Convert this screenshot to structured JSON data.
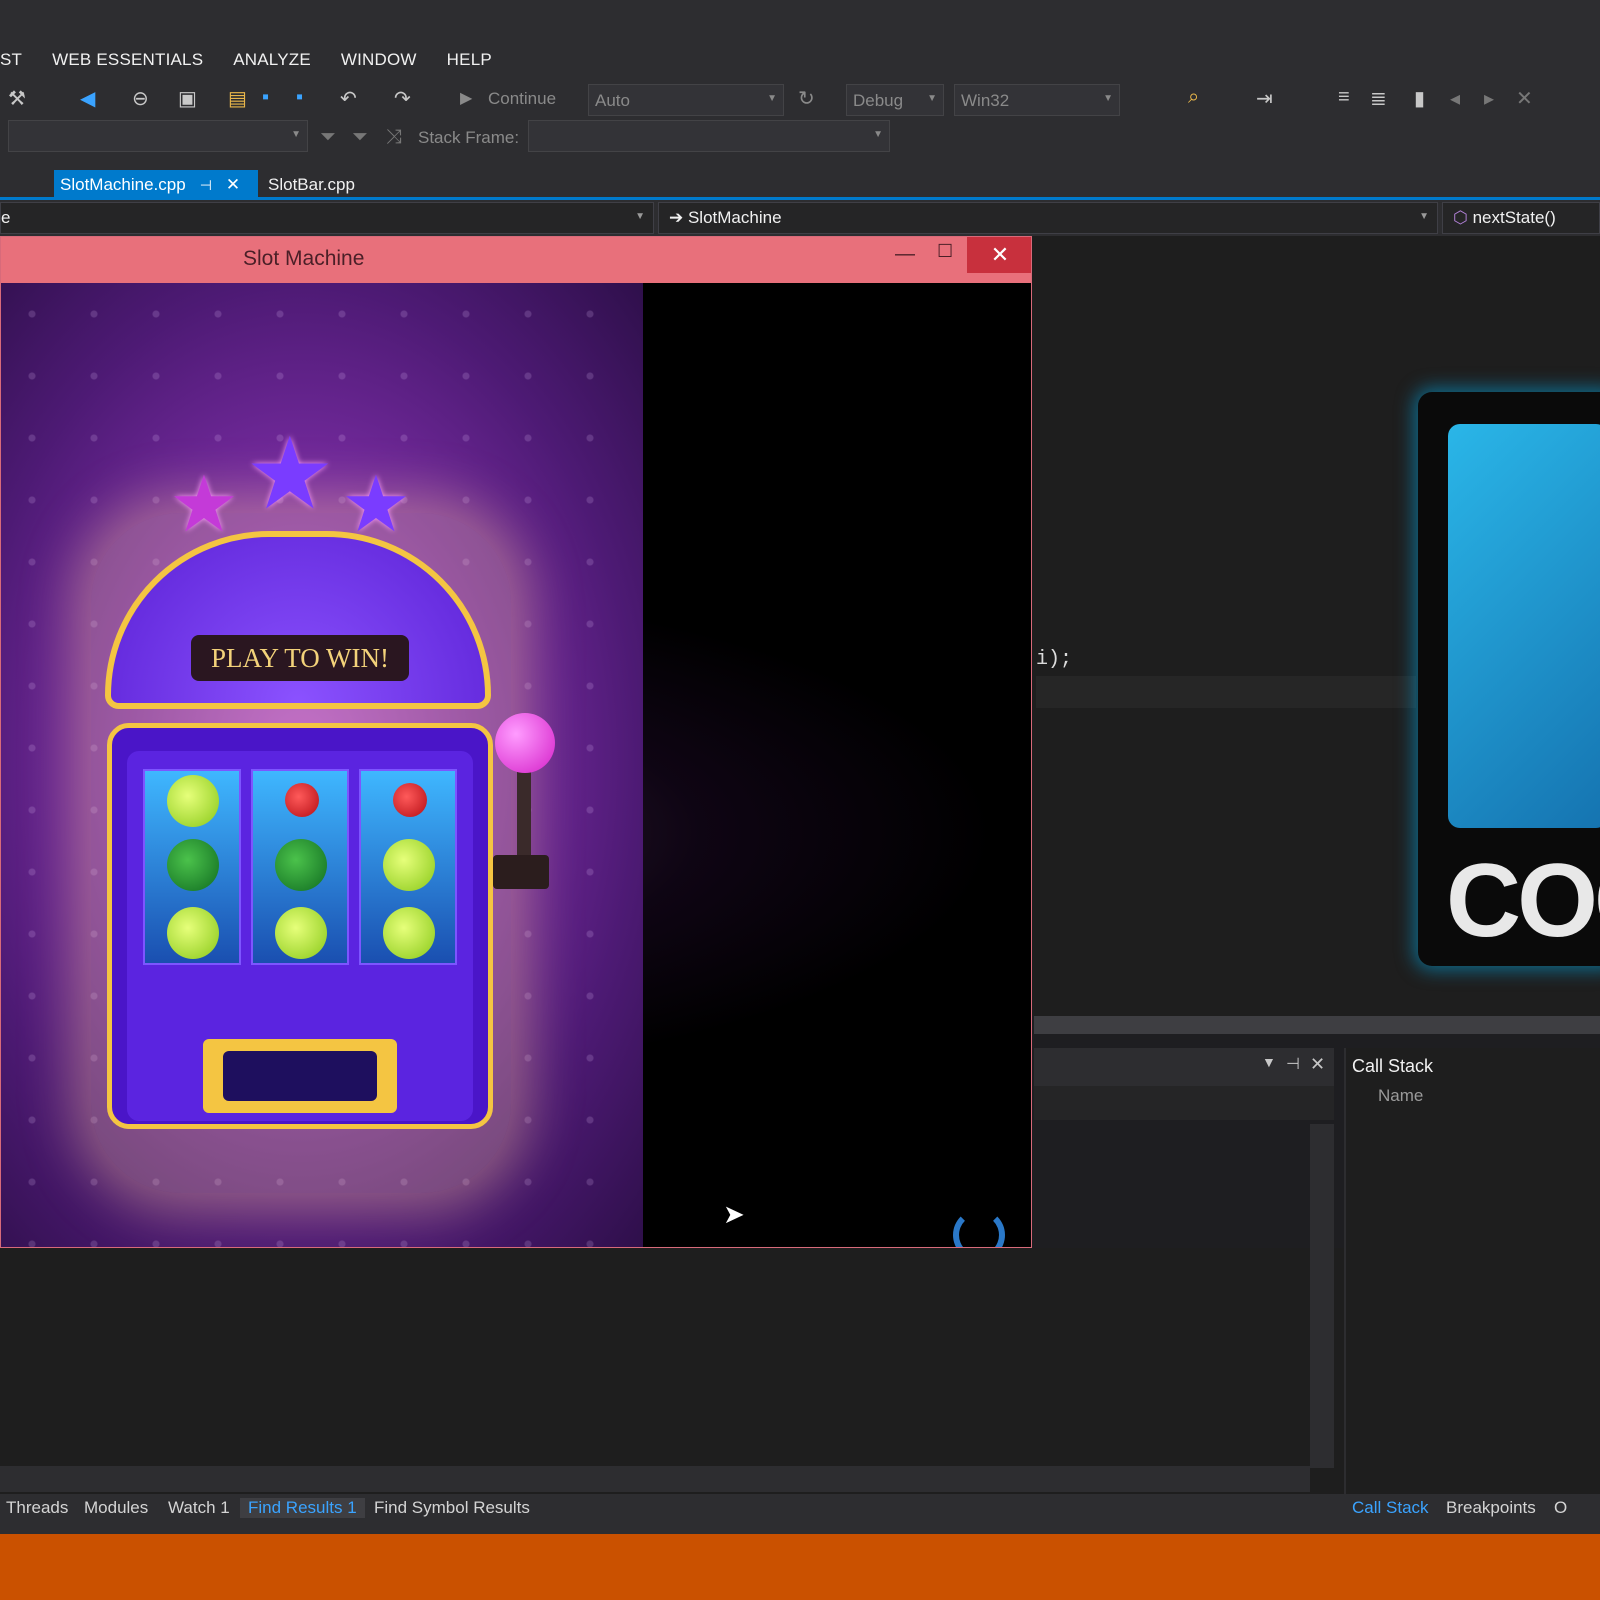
{
  "menu": {
    "items": [
      "ST",
      "WEB ESSENTIALS",
      "ANALYZE",
      "WINDOW",
      "HELP"
    ]
  },
  "toolbar": {
    "continue_label": "Continue",
    "solution_config": "Auto",
    "build_config": "Debug",
    "platform": "Win32",
    "stack_frame_label": "Stack Frame:"
  },
  "tabs": {
    "active": "SlotMachine.cpp",
    "pin_glyph": "⊣",
    "close_glyph": "✕",
    "second": "SlotBar.cpp"
  },
  "navbar": {
    "left_fragment": "e",
    "class_name": "SlotMachine",
    "member": "nextState()"
  },
  "editor": {
    "code_fragment": "i);"
  },
  "app_window": {
    "title": "Slot Machine",
    "min_glyph": "—",
    "max_glyph": "☐",
    "close_glyph": "✕",
    "banner": "PLAY TO WIN!"
  },
  "reels": [
    [
      "lime",
      "melon",
      "lime"
    ],
    [
      "cherry",
      "melon",
      "lime"
    ],
    [
      "cherry",
      "lime",
      "lime"
    ]
  ],
  "logo": {
    "text": "COC"
  },
  "panels": {
    "call_stack_title": "Call Stack",
    "call_stack_col": "Name"
  },
  "bottom_tabs": {
    "left": [
      "Threads",
      "Modules",
      "Watch 1",
      "Find Results 1",
      "Find Symbol Results"
    ],
    "active_left": "Find Results 1",
    "right": [
      "Call Stack",
      "Breakpoints",
      "O"
    ],
    "active_right": "Call Stack"
  },
  "colors": {
    "accent": "#007acc",
    "statusbar": "#ca5100",
    "app_titlebar": "#e8707b"
  }
}
